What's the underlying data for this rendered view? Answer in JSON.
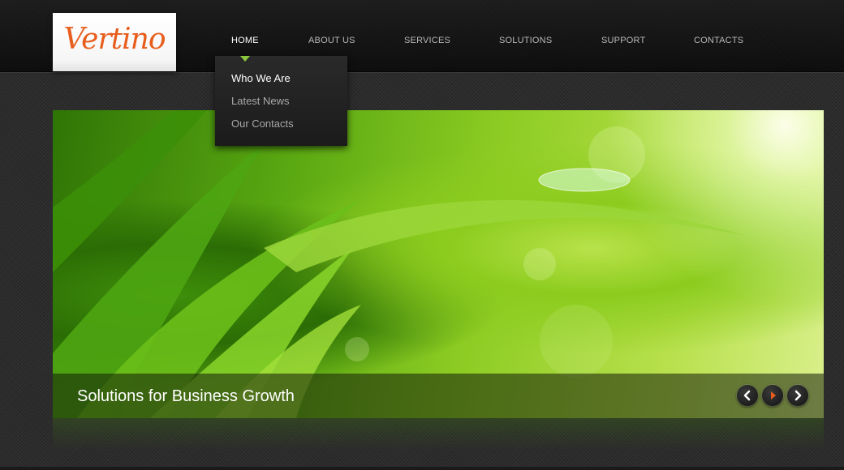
{
  "logo": {
    "text": "Vertino",
    "color": "#e85d1c"
  },
  "nav": {
    "items": [
      {
        "label": "HOME",
        "active": true
      },
      {
        "label": "ABOUT US"
      },
      {
        "label": "SERVICES"
      },
      {
        "label": "SOLUTIONS"
      },
      {
        "label": "SUPPORT"
      },
      {
        "label": "CONTACTS"
      }
    ],
    "accent_color": "#8cc63f"
  },
  "dropdown": {
    "items": [
      {
        "label": "Who We Are",
        "active": true
      },
      {
        "label": "Latest News"
      },
      {
        "label": "Our Contacts"
      }
    ]
  },
  "slider": {
    "caption": "Solutions for Business Growth",
    "controls": {
      "prev_icon": "chevron-left-icon",
      "play_icon": "play-icon",
      "next_icon": "chevron-right-icon"
    },
    "play_color": "#e85d1c"
  }
}
